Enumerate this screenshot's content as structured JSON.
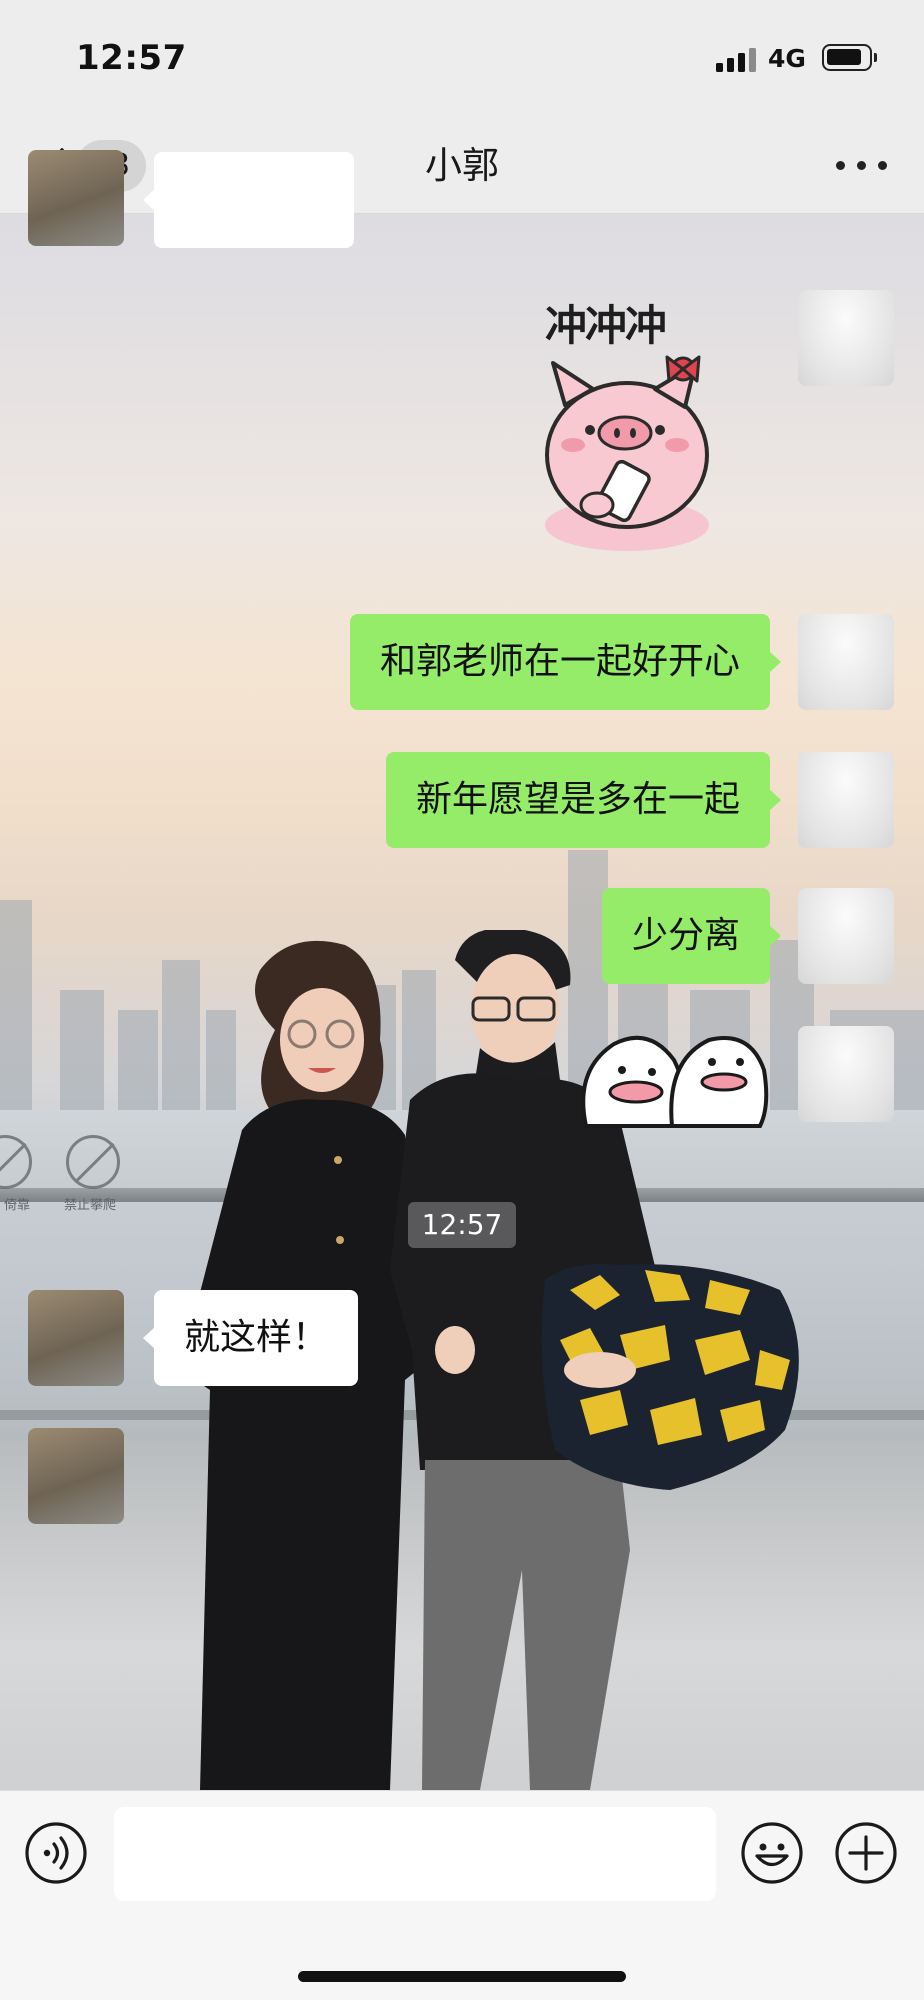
{
  "status_bar": {
    "time": "12:57",
    "network": "4G"
  },
  "nav": {
    "unread_count": "13",
    "title": "小郭"
  },
  "messages": [
    {
      "from": "other",
      "type": "text",
      "text": ""
    },
    {
      "from": "self",
      "type": "sticker",
      "sticker": "pig-holding-phone",
      "caption": "冲冲冲"
    },
    {
      "from": "self",
      "type": "text",
      "text": "和郭老师在一起好开心"
    },
    {
      "from": "self",
      "type": "text",
      "text": "新年愿望是多在一起"
    },
    {
      "from": "self",
      "type": "text",
      "text": "少分离"
    },
    {
      "from": "self",
      "type": "sticker",
      "sticker": "two-ghosts-pout"
    },
    {
      "type": "timestamp",
      "text": "12:57"
    },
    {
      "from": "other",
      "type": "text",
      "text": "就这样！"
    },
    {
      "from": "other",
      "type": "image"
    }
  ],
  "background": {
    "signs": [
      "倚靠",
      "禁止攀爬"
    ]
  },
  "input_bar": {
    "voice_icon": "voice-icon",
    "emoji_icon": "emoji-icon",
    "plus_icon": "plus-icon",
    "text_value": ""
  },
  "colors": {
    "self_bubble": "#95ec69",
    "other_bubble": "#ffffff",
    "bar_bg": "#ededed"
  }
}
